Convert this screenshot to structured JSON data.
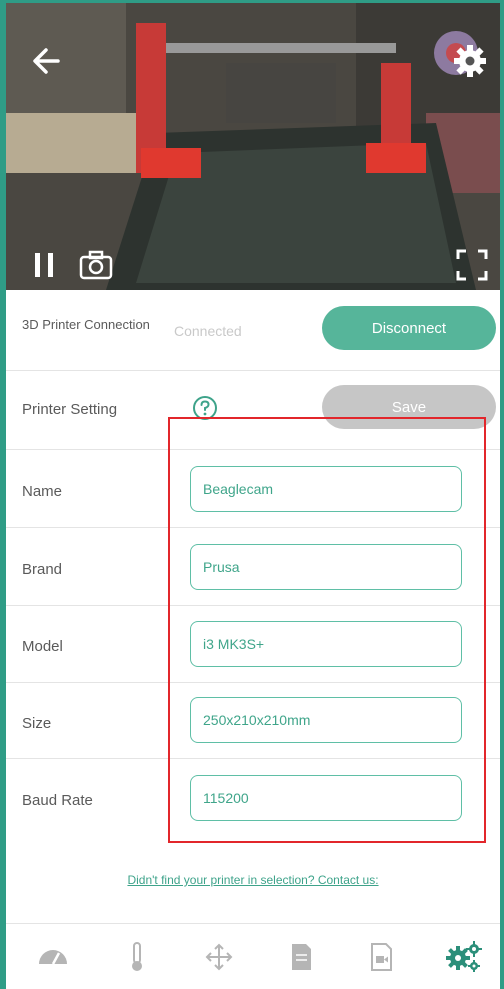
{
  "camera": {
    "icons": [
      "arrow-left-icon",
      "gear-icon",
      "pause-icon",
      "camera-icon",
      "fullscreen-icon"
    ]
  },
  "connection": {
    "label": "3D Printer Connection",
    "status": "Connected",
    "button": "Disconnect"
  },
  "settings": {
    "label": "Printer Setting",
    "help_icon": "question-circle-icon",
    "save_label": "Save"
  },
  "fields": [
    {
      "label": "Name",
      "value": "Beaglecam"
    },
    {
      "label": "Brand",
      "value": "Prusa"
    },
    {
      "label": "Model",
      "value": "i3 MK3S+"
    },
    {
      "label": "Size",
      "value": "250x210x210mm"
    },
    {
      "label": "Baud Rate",
      "value": "115200"
    }
  ],
  "contact_link": "Didn't find your printer in selection? Contact us:",
  "tabs": [
    {
      "name": "dashboard-icon"
    },
    {
      "name": "thermometer-icon"
    },
    {
      "name": "move-icon"
    },
    {
      "name": "files-icon"
    },
    {
      "name": "video-file-icon"
    },
    {
      "name": "settings-gears-icon",
      "active": true
    }
  ],
  "colors": {
    "accent": "#56b59a",
    "highlight_border": "#e2262b",
    "disabled": "#c6c6c6"
  }
}
